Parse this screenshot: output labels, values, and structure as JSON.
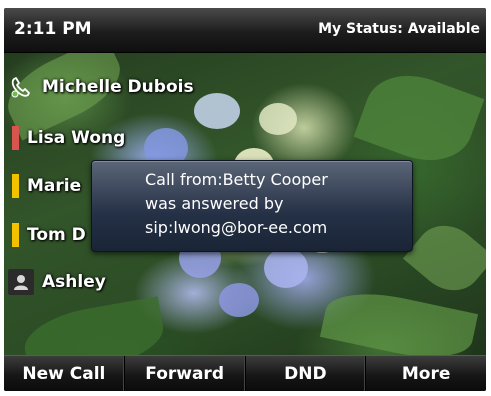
{
  "status_bar": {
    "time": "2:11 PM",
    "my_status": "My Status: Available"
  },
  "contacts": [
    {
      "name": "Michelle Dubois",
      "indicator": "phone-handset-icon"
    },
    {
      "name": "Lisa Wong",
      "indicator_color": "#d9534f"
    },
    {
      "name": "Marie",
      "indicator_color": "#f2c200"
    },
    {
      "name": "Tom D",
      "indicator_color": "#f2c200"
    },
    {
      "name": "Ashley",
      "indicator": "person-icon"
    }
  ],
  "popup": {
    "line1": "Call from:Betty Cooper",
    "line2": "was answered by",
    "line3": "sip:lwong@bor-ee.com"
  },
  "softkeys": {
    "new_call": "New Call",
    "forward": "Forward",
    "dnd": "DND",
    "more": "More"
  },
  "colors": {
    "popup_background": "#243045",
    "softkey_bar": "#161616",
    "status_busy": "#d9534f",
    "status_away": "#f2c200"
  }
}
